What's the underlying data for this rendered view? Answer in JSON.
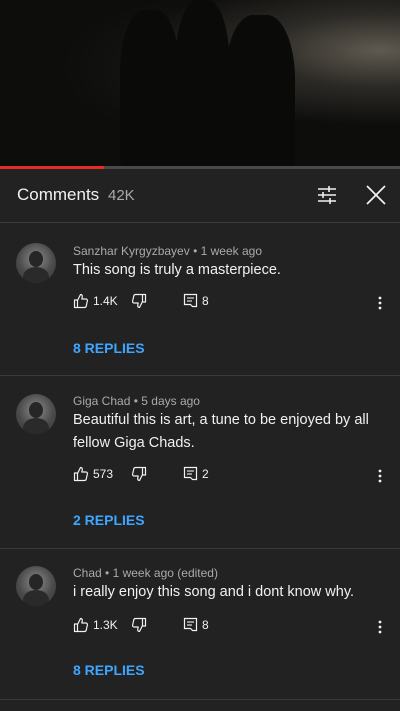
{
  "player": {
    "progress_fraction": 0.26,
    "buffered_fraction": 0.26
  },
  "comments_header": {
    "title": "Comments",
    "count": "42K"
  },
  "comments": [
    {
      "author": "Sanzhar Kyrgyzbayev",
      "time": "1 week ago",
      "text": "This song is truly a masterpiece.",
      "likes": "1.4K",
      "reply_count": "8",
      "replies_label": "8 REPLIES"
    },
    {
      "author": "Giga Chad",
      "time": "5 days ago",
      "text": "Beautiful this is art, a tune to be enjoyed by all fellow Giga Chads.",
      "likes": "573",
      "reply_count": "2",
      "replies_label": "2 REPLIES"
    },
    {
      "author": "Chad",
      "time": "1 week ago (edited)",
      "text": "i really enjoy this song and i dont know why.",
      "likes": "1.3K",
      "reply_count": "8",
      "replies_label": "8 REPLIES"
    }
  ],
  "colors": {
    "accent": "#3ea6ff",
    "progress": "#e52d27",
    "background": "#222222"
  },
  "icons": [
    "sort-filter-icon",
    "close-icon",
    "thumbs-up-icon",
    "thumbs-down-icon",
    "reply-icon",
    "more-vert-icon"
  ]
}
